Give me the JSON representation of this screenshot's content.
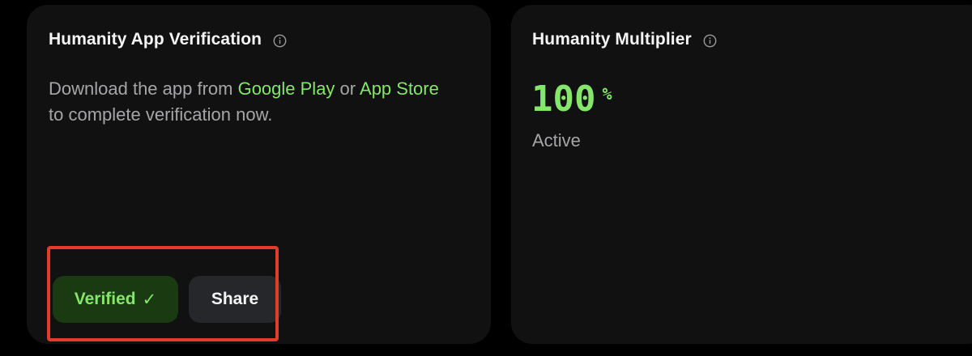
{
  "colors": {
    "background": "#000000",
    "card": "#111112",
    "accent_green": "#86e66b",
    "verified_bg": "#1a3a12",
    "share_bg": "#25272a",
    "highlight_red": "#e33c2a",
    "muted_text": "#a6a6a8"
  },
  "verification_card": {
    "title": "Humanity App Verification",
    "info_icon": "info-icon",
    "description": {
      "prefix": "Download the app from ",
      "google_play": "Google Play",
      "middle": " or ",
      "app_store": "App Store",
      "suffix": " to complete verification now."
    },
    "verified_button": {
      "label": "Verified",
      "icon": "checkmark-icon",
      "check_glyph": "✓"
    },
    "share_button": {
      "label": "Share"
    }
  },
  "multiplier_card": {
    "title": "Humanity Multiplier",
    "info_icon": "info-icon",
    "value": "100",
    "unit": "%",
    "status": "Active"
  }
}
